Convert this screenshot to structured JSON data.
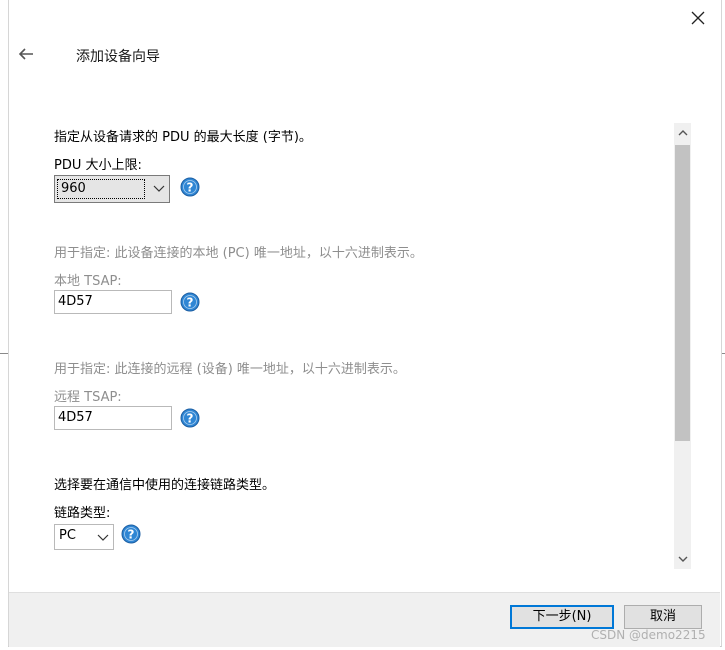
{
  "header": {
    "title": "添加设备向导",
    "close_icon": "close-icon",
    "back_icon": "back-arrow-icon"
  },
  "pdu": {
    "description": "指定从设备请求的  PDU 的最大长度 (字节)。",
    "label": "PDU 大小上限:",
    "value": "960"
  },
  "local_tsap": {
    "description": "用于指定: 此设备连接的本地 (PC) 唯一地址，以十六进制表示。",
    "label": "本地 TSAP:",
    "value": "4D57"
  },
  "remote_tsap": {
    "description": "用于指定: 此连接的远程 (设备) 唯一地址，以十六进制表示。",
    "label": "远程 TSAP:",
    "value": "4D57"
  },
  "link": {
    "description": "选择要在通信中使用的连接链路类型。",
    "label": "链路类型:",
    "value": "PC"
  },
  "footer": {
    "next_label": "下一步(N)",
    "cancel_label": "取消"
  },
  "watermark": "CSDN @demo2215",
  "colors": {
    "accent": "#0078d7",
    "help_icon": "#2f86d4",
    "disabled_text": "#8e8e8e"
  }
}
